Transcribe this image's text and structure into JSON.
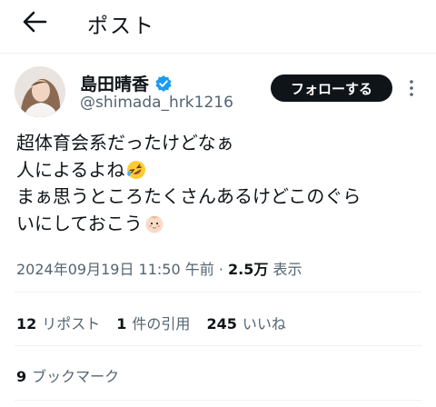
{
  "header": {
    "title": "ポスト",
    "back_icon": "arrow-left-icon"
  },
  "author": {
    "display_name": "島田晴香",
    "handle": "@shimada_hrk1216",
    "verified_icon": "verified-badge-icon",
    "verified_color": "#1d9bf0"
  },
  "follow_button": {
    "label": "フォローする"
  },
  "more_icon": "more-vertical-icon",
  "tweet": {
    "lines": [
      "超体育会系だったけどなぁ",
      "人によるよね",
      "まぁ思うところたくさんあるけどこのぐら",
      "いにしておこう"
    ],
    "emoji_line2": "rolling-on-floor-laughing-emoji",
    "emoji_line4": "baby-emoji"
  },
  "meta": {
    "timestamp": "2024年09月19日 11:50 午前",
    "separator": "·",
    "views_count": "2.5万",
    "views_label": "表示"
  },
  "stats": {
    "reposts_count": "12",
    "reposts_label": "リポスト",
    "quotes_count": "1",
    "quotes_label": "件の引用",
    "likes_count": "245",
    "likes_label": "いいね",
    "bookmarks_count": "9",
    "bookmarks_label": "ブックマーク"
  },
  "colors": {
    "text": "#0f1419",
    "secondary": "#536471",
    "divider": "#eff3f4",
    "accent": "#1d9bf0"
  }
}
